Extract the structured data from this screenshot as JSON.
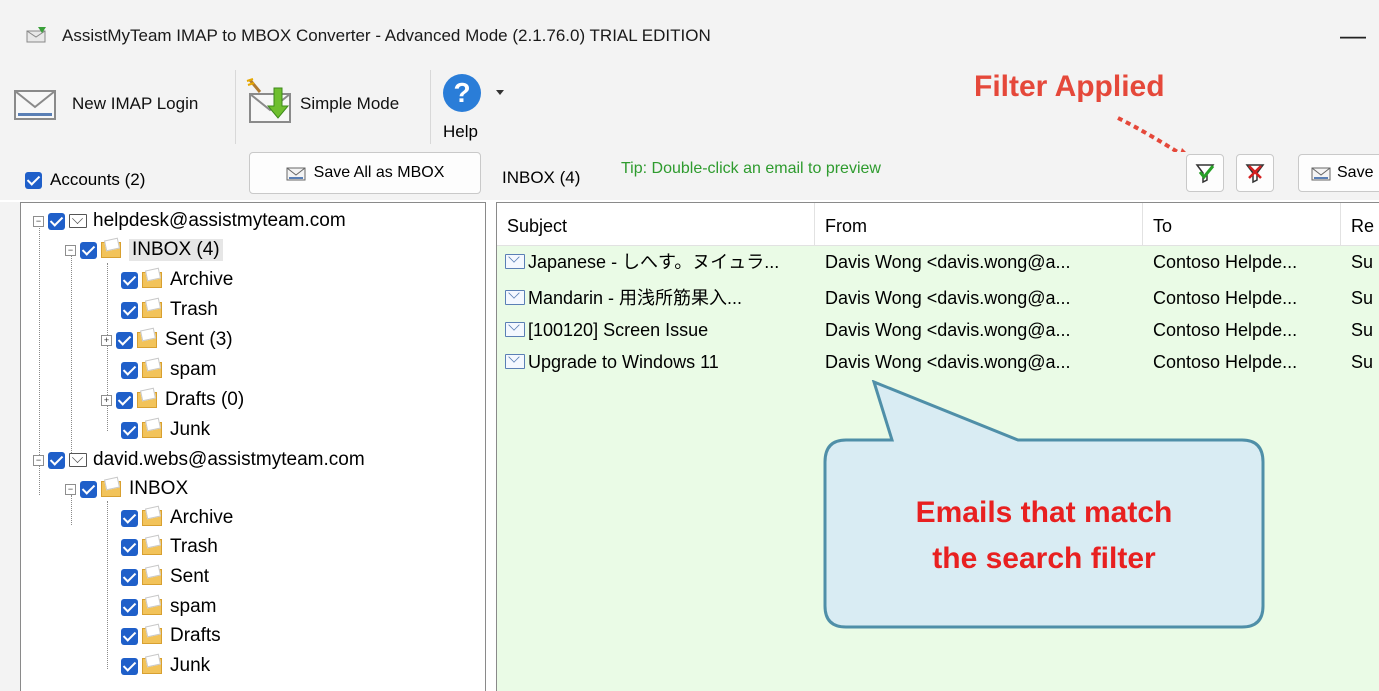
{
  "window": {
    "title": "AssistMyTeam IMAP to MBOX Converter - Advanced Mode (2.1.76.0) TRIAL EDITION",
    "minimize_glyph": "—"
  },
  "toolbar": {
    "new_login_label": "New IMAP Login",
    "simple_mode_label": "Simple Mode",
    "help_label": "Help",
    "help_glyph": "?"
  },
  "accounts": {
    "label": "Accounts (2)",
    "save_all_label": "Save All as MBOX",
    "tree": [
      {
        "label": "helpdesk@assistmyteam.com",
        "kind": "account"
      },
      {
        "label": "INBOX (4)",
        "kind": "folder",
        "selected": true
      },
      {
        "label": "Archive",
        "kind": "folder"
      },
      {
        "label": "Trash",
        "kind": "folder"
      },
      {
        "label": "Sent (3)",
        "kind": "folder"
      },
      {
        "label": "spam",
        "kind": "folder"
      },
      {
        "label": "Drafts (0)",
        "kind": "folder"
      },
      {
        "label": "Junk",
        "kind": "folder"
      },
      {
        "label": "david.webs@assistmyteam.com",
        "kind": "account"
      },
      {
        "label": "INBOX",
        "kind": "folder"
      },
      {
        "label": "Archive",
        "kind": "folder"
      },
      {
        "label": "Trash",
        "kind": "folder"
      },
      {
        "label": "Sent",
        "kind": "folder"
      },
      {
        "label": "spam",
        "kind": "folder"
      },
      {
        "label": "Drafts",
        "kind": "folder"
      },
      {
        "label": "Junk",
        "kind": "folder"
      }
    ]
  },
  "mail": {
    "folder_label": "INBOX (4)",
    "tip": "Tip: Double-click an email to preview",
    "save_label": "Save",
    "columns": [
      "Subject",
      "From",
      "To",
      "Re"
    ],
    "rows": [
      {
        "subject": "Japanese - しへす。ヌイュラ...",
        "from": "Davis Wong <davis.wong@a...",
        "to": "Contoso Helpde...",
        "re": "Su"
      },
      {
        "subject": "Mandarin - 用浅所筋果入...",
        "from": "Davis Wong <davis.wong@a...",
        "to": "Contoso Helpde...",
        "re": "Su"
      },
      {
        "subject": "[100120] Screen Issue",
        "from": "Davis Wong <davis.wong@a...",
        "to": "Contoso Helpde...",
        "re": "Su"
      },
      {
        "subject": "Upgrade to Windows 11",
        "from": "Davis Wong <davis.wong@a...",
        "to": "Contoso Helpde...",
        "re": "Su"
      }
    ]
  },
  "annotations": {
    "filter_applied": "Filter Applied",
    "callout_line1": "Emails that match",
    "callout_line2": "the search filter"
  },
  "colors": {
    "accent": "#1f5fc9",
    "tip_green": "#2e9b2e",
    "annotation_red": "#e5483a",
    "grid_bg": "#eafbe6",
    "callout_bg": "#d9ecf3",
    "callout_border": "#4f8fa8"
  },
  "icons": [
    "app-icon",
    "envelope-icon",
    "wand-envelope-icon",
    "help-icon",
    "filter-applied-icon",
    "clear-filter-icon",
    "mbox-save-icon",
    "folder-icon",
    "mail-icon",
    "attachment-mail-icon"
  ]
}
